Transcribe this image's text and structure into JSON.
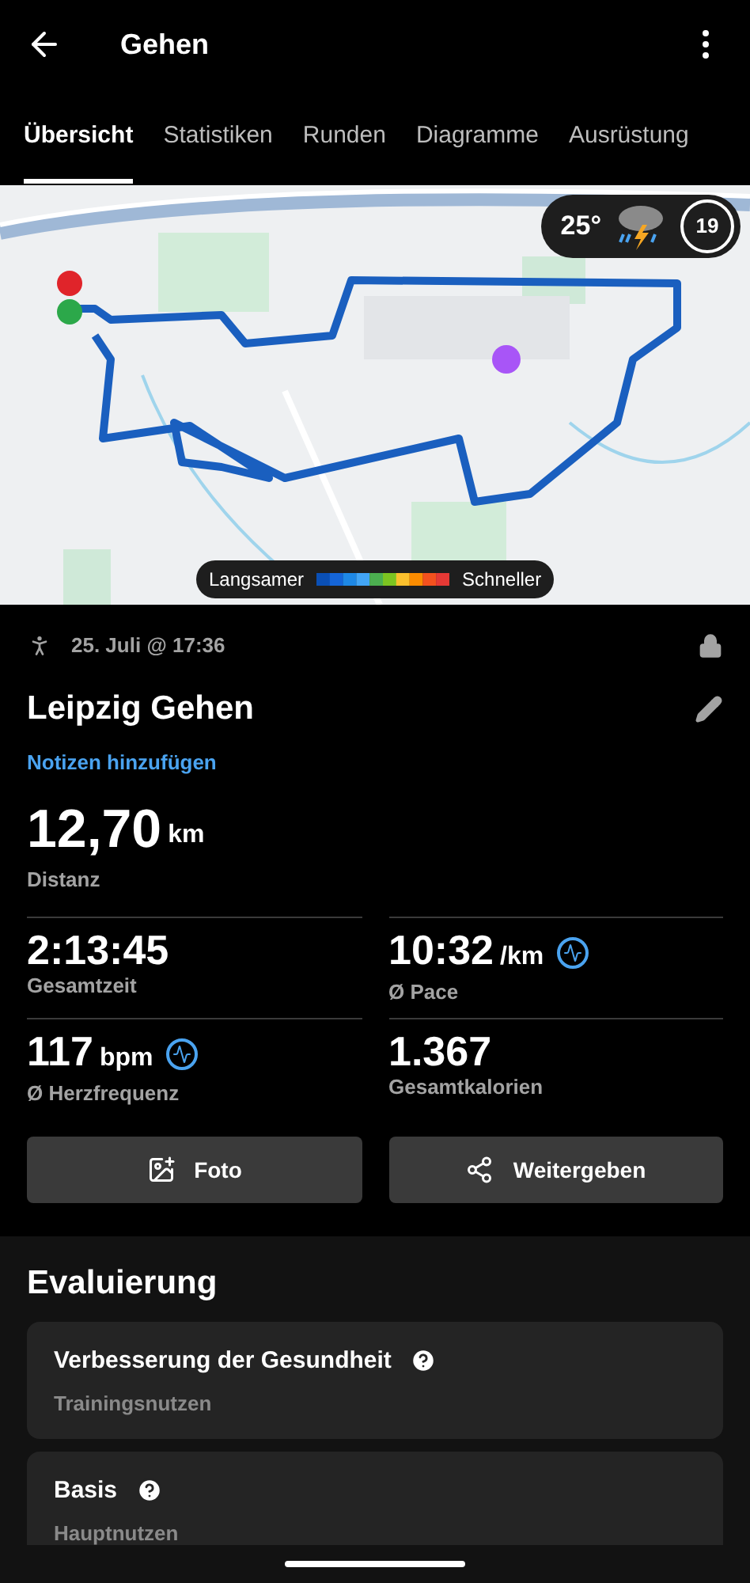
{
  "header": {
    "title": "Gehen"
  },
  "tabs": [
    {
      "label": "Übersicht",
      "selected": true
    },
    {
      "label": "Statistiken",
      "selected": false
    },
    {
      "label": "Runden",
      "selected": false
    },
    {
      "label": "Diagramme",
      "selected": false
    },
    {
      "label": "Ausrüstung",
      "selected": false
    }
  ],
  "map": {
    "weather": {
      "temperature": "25°",
      "badge": "19"
    },
    "legend": {
      "slow": "Langsamer",
      "fast": "Schneller"
    }
  },
  "activity": {
    "date": "25. Juli @ 17:36",
    "locked": true,
    "name": "Leipzig Gehen",
    "notes_link": "Notizen hinzufügen"
  },
  "distance": {
    "value": "12,70",
    "unit": "km",
    "label": "Distanz"
  },
  "metrics": [
    {
      "value": "2:13:45",
      "label": "Gesamtzeit",
      "has_chart": false
    },
    {
      "value": "10:32",
      "unit": "/km",
      "label": "Ø Pace",
      "has_chart": true
    },
    {
      "value": "117",
      "unit": "bpm",
      "label": "Ø Herzfrequenz",
      "has_chart": true
    },
    {
      "value": "1.367",
      "label": "Gesamtkalorien",
      "has_chart": false
    }
  ],
  "buttons": [
    {
      "label": "Foto"
    },
    {
      "kind": "share",
      "label": "Weitergeben"
    }
  ],
  "evaluation": {
    "title": "Evaluierung",
    "cards": [
      {
        "title": "Verbesserung der Gesundheit",
        "subtitle": "Trainingsnutzen"
      },
      {
        "title": "Basis",
        "subtitle": "Hauptnutzen"
      }
    ]
  }
}
